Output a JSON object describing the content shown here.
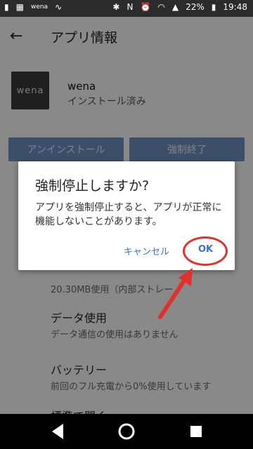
{
  "status": {
    "left_icons": [
      "storage-icon",
      "image-icon",
      "wena-notification",
      "activity-icon"
    ],
    "left_text": "wena",
    "battery": "22%",
    "time": "19:48"
  },
  "appbar": {
    "title": "アプリ情報"
  },
  "app": {
    "icon_text": "wena",
    "name": "wena",
    "status": "インストール済み"
  },
  "buttons": {
    "uninstall": "アンインストール",
    "force_stop": "強制終了"
  },
  "items": [
    {
      "sub": "20.30MB使用（内部ストレー"
    },
    {
      "title": "データ使用",
      "sub": "データ通信の使用はありません"
    },
    {
      "title": "バッテリー",
      "sub": "前回のフル充電から0%使用しています"
    },
    {
      "title": "標準で開く"
    }
  ],
  "dialog": {
    "title": "強制停止しますか?",
    "message": "アプリを強制停止すると、アプリが正常に機能しないことがあります。",
    "cancel": "キャンセル",
    "ok": "OK"
  },
  "colors": {
    "accent": "#3a6fc7",
    "annotation": "#e0322b"
  }
}
